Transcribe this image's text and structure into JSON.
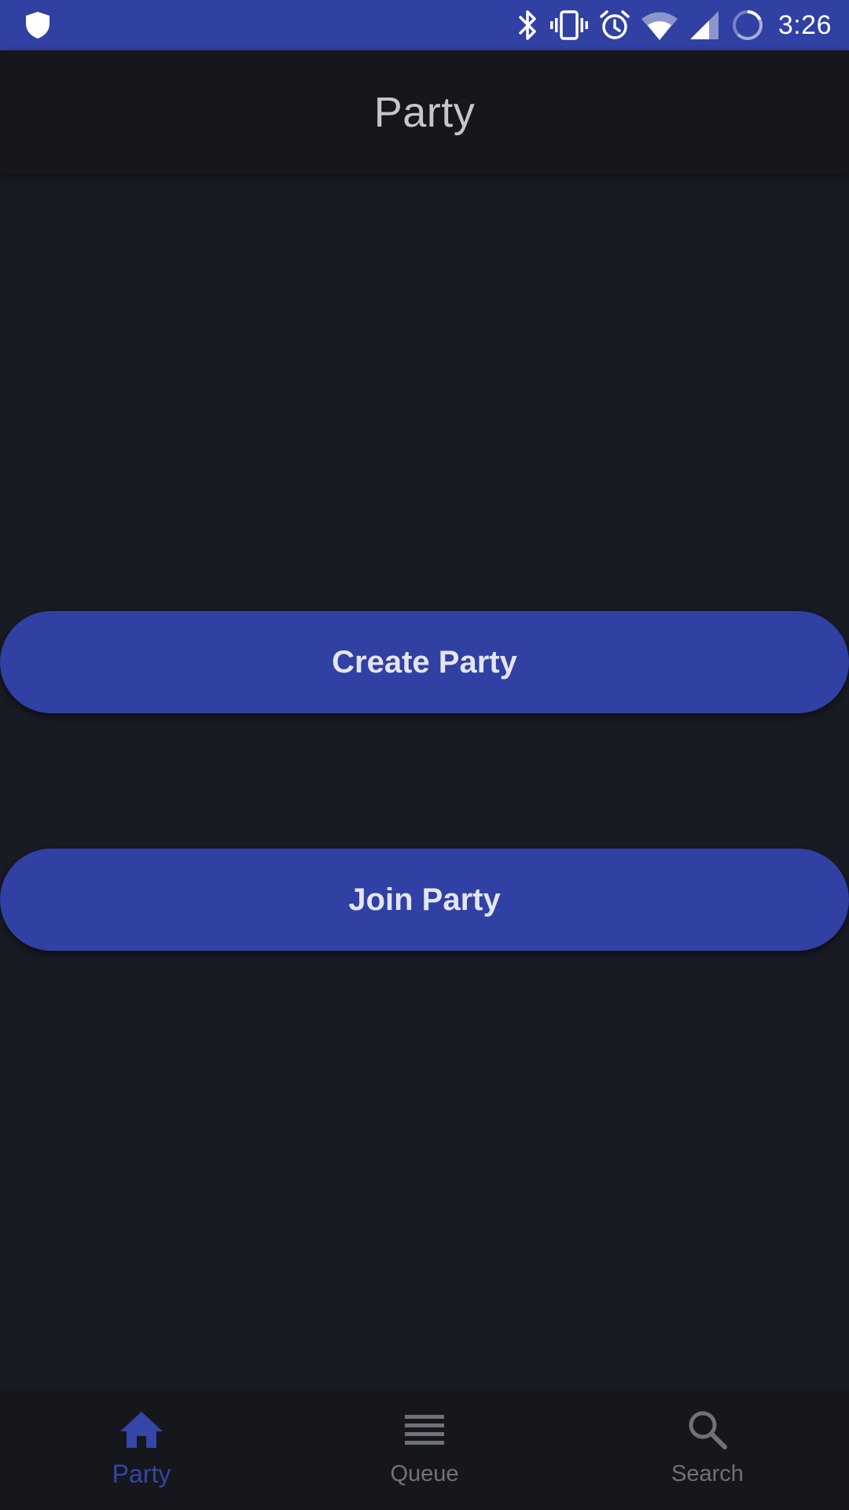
{
  "status_bar": {
    "time": "3:26",
    "background_color": "#3040a3",
    "icons": [
      "shield-icon",
      "bluetooth-icon",
      "vibrate-icon",
      "alarm-icon",
      "wifi-icon",
      "cell-signal-icon",
      "battery-charging-icon"
    ]
  },
  "app_bar": {
    "title": "Party"
  },
  "main": {
    "create_party_label": "Create Party",
    "join_party_label": "Join Party",
    "button_color": "#3040a3"
  },
  "bottom_nav": {
    "items": [
      {
        "label": "Party",
        "icon": "home-icon",
        "active": true
      },
      {
        "label": "Queue",
        "icon": "queue-list-icon",
        "active": false
      },
      {
        "label": "Search",
        "icon": "search-icon",
        "active": false
      }
    ],
    "active_color": "#3545a8",
    "inactive_color": "#6f7278"
  }
}
